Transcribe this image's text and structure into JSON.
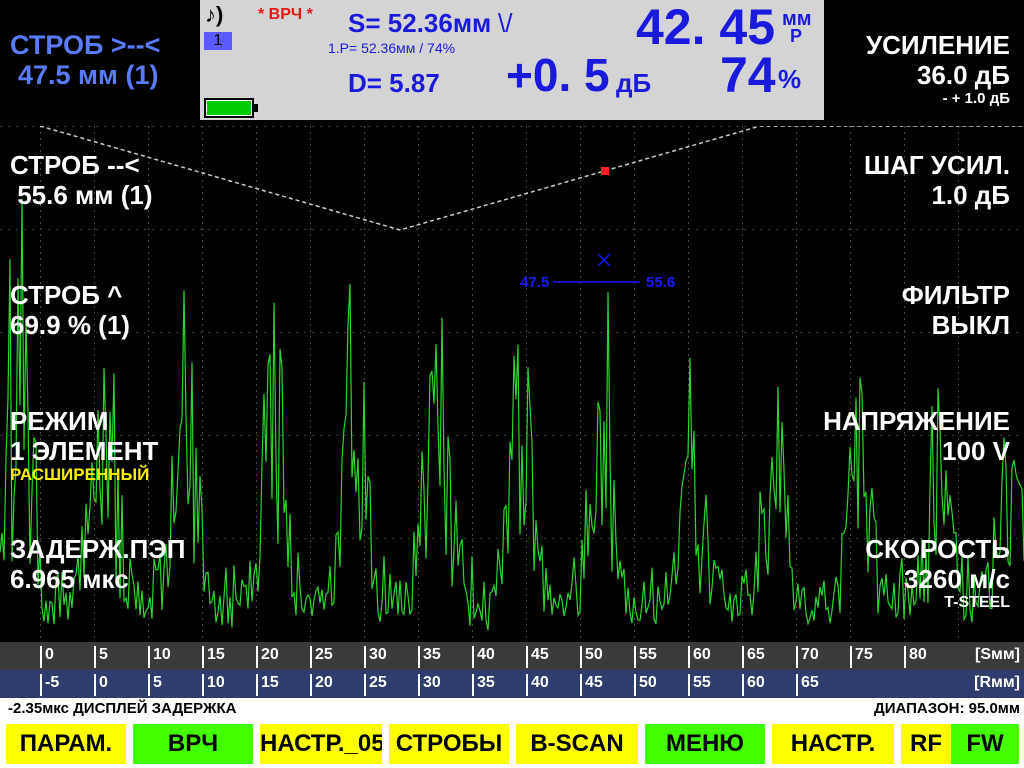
{
  "top_left": {
    "title": "СТРОБ >--<",
    "value": "47.5 мм (1)"
  },
  "status": {
    "sound_icon": "♪)",
    "channel": "1",
    "mode": "* ВРЧ *",
    "s_value": "S=  52.36мм",
    "s_mark": "\\/",
    "p_line": "1.P=  52.36мм / 74%",
    "d_value": "D=  5.87",
    "big_depth": "42. 45",
    "depth_unit": "мм",
    "depth_sub": "P",
    "gain_delta": "+0. 5",
    "gain_delta_unit": "дБ",
    "amp_value": "74",
    "amp_unit": "%",
    "battery_color": "#00cc00"
  },
  "top_right": {
    "title": "УСИЛЕНИЕ",
    "value": "36.0 дБ",
    "step": "- +  1.0 дБ"
  },
  "left_panel": [
    {
      "title": "СТРОБ --<",
      "value": " 55.6 мм (1)"
    },
    {
      "title": "СТРОБ ^",
      "value": "69.9 % (1)"
    },
    {
      "title": "РЕЖИМ",
      "value": "1 ЭЛЕМЕНТ",
      "extra": "РАСШИРЕННЫЙ"
    },
    {
      "title": "ЗАДЕРЖ.ПЭП",
      "value": "6.965 мкс"
    }
  ],
  "right_panel": [
    {
      "title": "ШАГ УСИЛ.",
      "value": "1.0 дБ"
    },
    {
      "title": "ФИЛЬТР",
      "value": "ВЫКЛ"
    },
    {
      "title": "НАПРЯЖЕНИЕ",
      "value": "100 V"
    },
    {
      "title": "СКОРОСТЬ",
      "value": "3260 м/с",
      "extra": "T-STEEL"
    }
  ],
  "gate": {
    "start_label": "47.5",
    "end_label": "55.6"
  },
  "scale_s": {
    "labels": [
      "0",
      "5",
      "10",
      "15",
      "20",
      "25",
      "30",
      "35",
      "40",
      "45",
      "50",
      "55",
      "60",
      "65",
      "70",
      "75",
      "80"
    ],
    "unit": "[Sмм]"
  },
  "scale_r": {
    "labels": [
      "-5",
      "0",
      "5",
      "10",
      "15",
      "20",
      "25",
      "30",
      "35",
      "40",
      "45",
      "50",
      "55",
      "60",
      "65"
    ],
    "unit": "[Rмм]"
  },
  "info": {
    "left": "-2.35мкс  ДИСПЛЕЙ ЗАДЕРЖКА",
    "right": "ДИАПАЗОН:  95.0мм"
  },
  "softkeys": [
    {
      "label": "ПАРАМ.",
      "color": "yellow"
    },
    {
      "label": "ВРЧ",
      "color": "green"
    },
    {
      "label": "НАСТР._05",
      "color": "yellow"
    },
    {
      "label": "СТРОБЫ",
      "color": "yellow"
    },
    {
      "label": "B-SCAN",
      "color": "yellow"
    },
    {
      "label": "МЕНЮ",
      "color": "green"
    },
    {
      "label": "НАСТР.",
      "color": "yellow"
    },
    {
      "label": "RF",
      "color": "yellow"
    },
    {
      "label": "FW",
      "color": "green"
    }
  ],
  "colors": {
    "signal": "#2bd62b",
    "grid": "#5a5a5a",
    "accent_blue": "#1a1adc",
    "mode_red": "#e81515"
  }
}
